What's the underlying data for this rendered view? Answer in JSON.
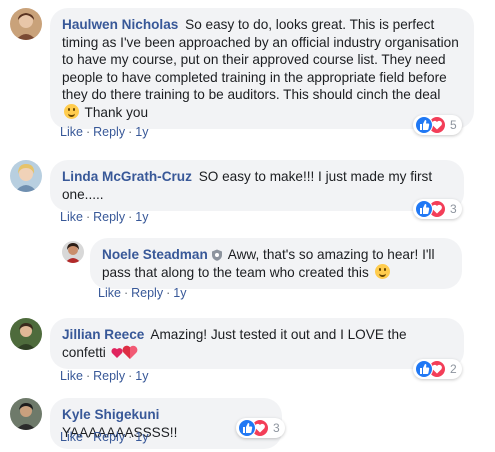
{
  "colors": {
    "author": "#385898",
    "bubble": "#f2f3f5",
    "like": "#2078f4",
    "love": "#f33e58"
  },
  "comments": [
    {
      "author": "Haulwen Nicholas",
      "text": "So easy to do, looks great. This is perfect timing as I've been approached by an official industry organisation to have my course, put on their approved course list. They need people to have completed training in the appropriate field before they do there training to be auditors. This should cinch the deal",
      "text_after": "Thank you",
      "like": "Like",
      "reply": "Reply",
      "time": "1y",
      "reaction_count": "5"
    },
    {
      "author": "Linda McGrath-Cruz",
      "text": "SO easy to make!!! I just made my first one.....",
      "like": "Like",
      "reply": "Reply",
      "time": "1y",
      "reaction_count": "3"
    },
    {
      "author": "Noele Steadman",
      "text": "Aww, that's so amazing to hear! I'll pass that along to the team who created this",
      "like": "Like",
      "reply": "Reply",
      "time": "1y"
    },
    {
      "author": "Jillian Reece",
      "text": "Amazing! Just tested it out and I LOVE the confetti",
      "like": "Like",
      "reply": "Reply",
      "time": "1y",
      "reaction_count": "2"
    },
    {
      "author": "Kyle Shigekuni",
      "text": "YAAAAAAASSSS!!",
      "like": "Like",
      "reply": "Reply",
      "time": "1y",
      "reaction_count": "3"
    }
  ]
}
